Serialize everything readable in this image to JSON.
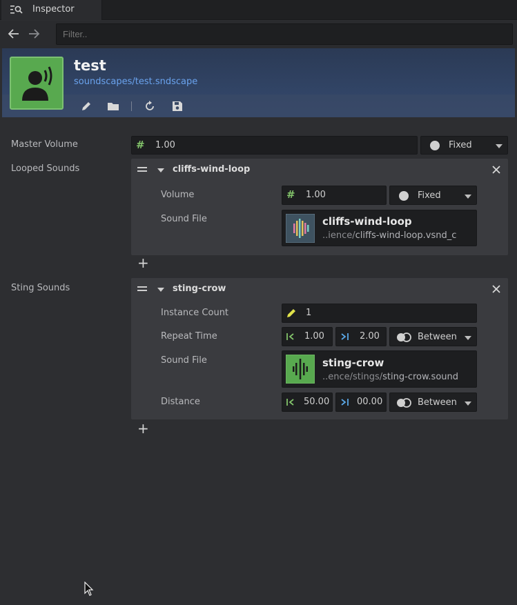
{
  "tab": {
    "label": "Inspector"
  },
  "filter": {
    "placeholder": "Filter.."
  },
  "asset": {
    "title": "test",
    "path": "soundscapes/test.sndscape"
  },
  "master": {
    "label": "Master Volume",
    "value": "1.00",
    "mode": "Fixed"
  },
  "looped": {
    "label": "Looped Sounds",
    "item": {
      "name": "cliffs-wind-loop",
      "volume_label": "Volume",
      "volume_value": "1.00",
      "volume_mode": "Fixed",
      "file_label": "Sound File",
      "file_name": "cliffs-wind-loop",
      "file_path_prefix": "..ience/",
      "file_path_name": "cliffs-wind-loop.vsnd_c"
    }
  },
  "sting": {
    "label": "Sting Sounds",
    "item": {
      "name": "sting-crow",
      "instance_label": "Instance Count",
      "instance_value": "1",
      "repeat_label": "Repeat Time",
      "repeat_min": "1.00",
      "repeat_max": "2.00",
      "repeat_mode": "Between",
      "file_label": "Sound File",
      "file_name": "sting-crow",
      "file_path_prefix": "..ence/stings/",
      "file_path_name": "sting-crow.sound",
      "distance_label": "Distance",
      "distance_min": "50.00",
      "distance_max": "00.00",
      "distance_mode": "Between"
    }
  },
  "colors": {
    "accent_green": "#58a94f",
    "link_blue": "#6aa3ee",
    "hash_green": "#82c36a",
    "range_blue": "#5aa7e6"
  }
}
